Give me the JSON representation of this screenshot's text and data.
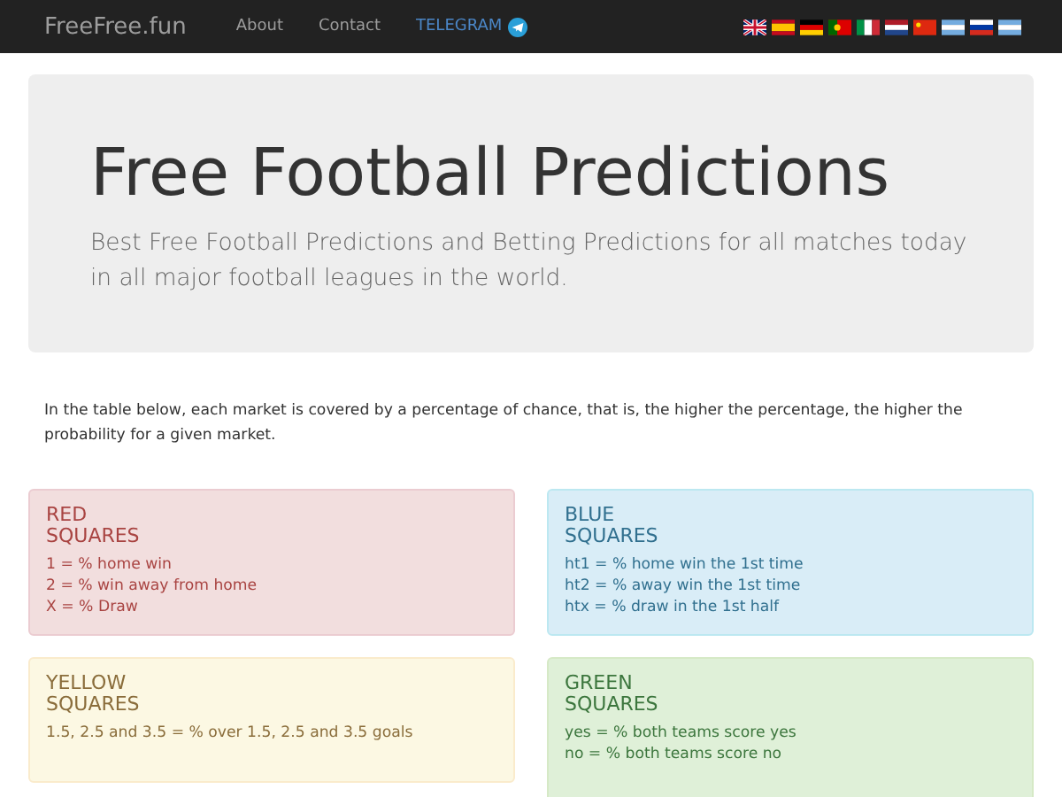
{
  "navbar": {
    "brand": "FreeFree.fun",
    "links": [
      {
        "label": "About",
        "kind": "plain"
      },
      {
        "label": "Contact",
        "kind": "plain"
      },
      {
        "label": "TELEGRAM",
        "kind": "telegram"
      }
    ]
  },
  "hero": {
    "title": "Free Football Predictions",
    "subtitle": "Best Free Football Predictions and Betting Predictions for all matches today in all major football leagues in the world."
  },
  "intro": "In the table below, each market is covered by a percentage of chance, that is, the higher the percentage, the higher the probability for a given market.",
  "cards": [
    {
      "kind": "red",
      "title": [
        "RED",
        "SQUARES"
      ],
      "lines": [
        "1 = % home win",
        "2 = % win away from home",
        "X = % Draw"
      ]
    },
    {
      "kind": "blue",
      "title": [
        "BLUE",
        "SQUARES"
      ],
      "lines": [
        "ht1 = % home win the 1st time",
        "ht2 = % away win the 1st time",
        "htx = % draw in the 1st half"
      ]
    },
    {
      "kind": "yellow",
      "title": [
        "YELLOW",
        "SQUARES"
      ],
      "lines": [
        "1.5, 2.5 and 3.5 = % over 1.5, 2.5 and 3.5 goals"
      ]
    },
    {
      "kind": "green",
      "title": [
        "GREEN",
        "SQUARES"
      ],
      "lines": [
        "yes = % both teams score yes",
        "no = % both teams score no"
      ]
    }
  ]
}
